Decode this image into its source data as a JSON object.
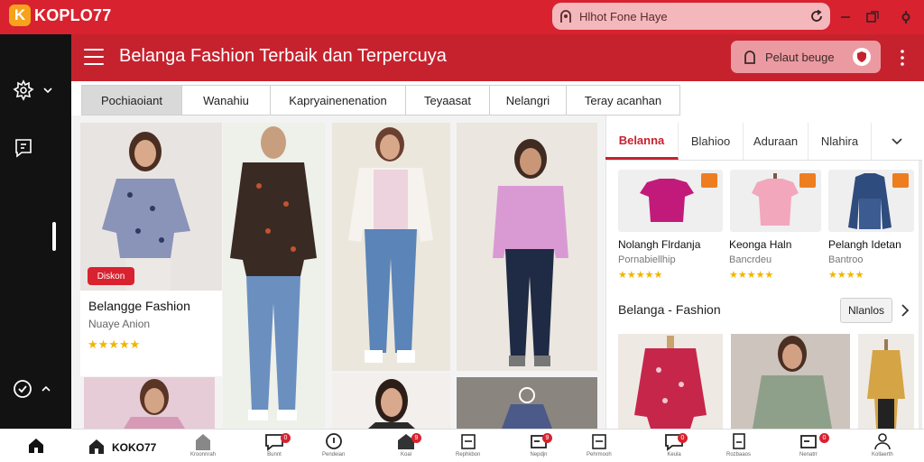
{
  "topbar": {
    "logo_mark": "K",
    "brand": "KOPLO77",
    "search_text": "Hlhot Fone Haye",
    "colors": {
      "brand_red": "#d8222f",
      "header_red": "#c6222e",
      "logo_orange": "#f7a21b"
    }
  },
  "header": {
    "title": "Belanga Fashion Terbaik dan Terpercuya",
    "account_label": "Pelaut beuge"
  },
  "categories": [
    {
      "label": "Pochiaoiant",
      "active": true
    },
    {
      "label": "Wanahiu",
      "active": false
    },
    {
      "label": "Kapryainenenation",
      "active": false
    },
    {
      "label": "Teyaasat",
      "active": false
    },
    {
      "label": "Nelangri",
      "active": false
    },
    {
      "label": "Teray acanhan",
      "active": false
    }
  ],
  "featured_card": {
    "badge": "Diskon",
    "title": "Belangge Fashion",
    "subtitle": "Nuaye Anion",
    "stars": "★★★★★"
  },
  "right_tabs": [
    {
      "label": "Belanna",
      "active": true
    },
    {
      "label": "Blahioo",
      "active": false
    },
    {
      "label": "Aduraan",
      "active": false
    },
    {
      "label": "Nlahira",
      "active": false
    }
  ],
  "thumbs": [
    {
      "name": "Nolangh Flrdanja",
      "sub": "Pornabiellhip",
      "stars": "★★★★★",
      "icon": "tshirt-magenta-icon"
    },
    {
      "name": "Keonga Haln",
      "sub": "Bancrdeu",
      "stars": "★★★★★",
      "icon": "tshirt-pink-icon"
    },
    {
      "name": "Pelangh Idetan",
      "sub": "Bantroo",
      "stars": "★★★★",
      "icon": "denim-jacket-icon"
    }
  ],
  "section": {
    "title": "Belanga - Fashion",
    "more_label": "Nlanlos"
  },
  "bottom_nav": {
    "brand": "KOKO77",
    "items": [
      {
        "icon": "home-icon",
        "caption": "Kroonnrah",
        "badge": ""
      },
      {
        "icon": "chat-icon",
        "caption": "Bunnt",
        "badge": "0"
      },
      {
        "icon": "info-icon",
        "caption": "Pendeian",
        "badge": ""
      },
      {
        "icon": "store-icon",
        "caption": "Koal",
        "badge": "9"
      },
      {
        "icon": "doc-icon",
        "caption": "Rephkbon",
        "badge": ""
      },
      {
        "icon": "inbox-icon",
        "caption": "Nepdjn",
        "badge": "9"
      },
      {
        "icon": "doc-icon",
        "caption": "Pehrmooh",
        "badge": ""
      },
      {
        "icon": "chat-icon",
        "caption": "Keula",
        "badge": "0"
      },
      {
        "icon": "receipt-icon",
        "caption": "Rozbaaos",
        "badge": ""
      },
      {
        "icon": "inbox-icon",
        "caption": "Nenatrr",
        "badge": "0"
      },
      {
        "icon": "person-icon",
        "caption": "Kollaerth",
        "badge": ""
      }
    ]
  }
}
